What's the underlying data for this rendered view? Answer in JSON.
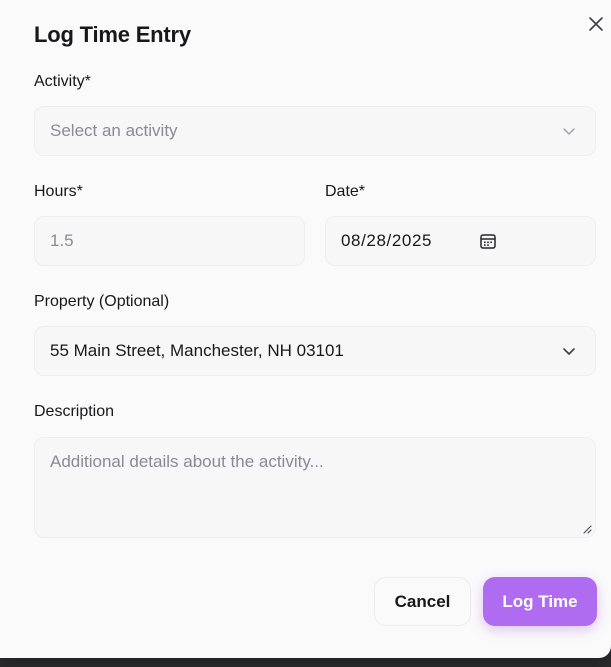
{
  "dialog": {
    "title": "Log Time Entry",
    "close_icon": "close-icon"
  },
  "fields": {
    "activity": {
      "label": "Activity*",
      "placeholder": "Select an activity",
      "icon": "chevron-down-icon"
    },
    "hours": {
      "label": "Hours*",
      "placeholder": "1.5"
    },
    "date": {
      "label": "Date*",
      "value": "08/28/2025",
      "icon": "calendar-icon"
    },
    "property": {
      "label": "Property (Optional)",
      "value": "55 Main Street, Manchester, NH 03101",
      "icon": "chevron-down-icon"
    },
    "description": {
      "label": "Description",
      "placeholder": "Additional details about the activity..."
    }
  },
  "actions": {
    "cancel_label": "Cancel",
    "submit_label": "Log Time"
  },
  "colors": {
    "primary": "#b06cf0",
    "background": "#fafafa",
    "overlay": "#2b2b2e"
  }
}
